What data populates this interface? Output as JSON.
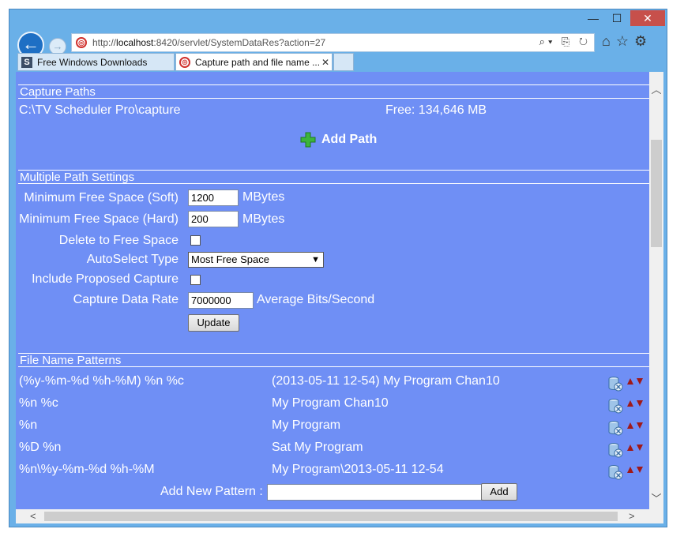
{
  "window": {
    "minimize": "—",
    "maximize": "☐",
    "close": "✕"
  },
  "nav": {
    "url_prefix": "http://",
    "url_host": "localhost",
    "url_rest": ":8420/servlet/SystemDataRes?action=27",
    "tools": "⌕▾ ⎘ ↻",
    "home_icon": "⌂",
    "star_icon": "☆",
    "gear_icon": "⚙"
  },
  "tabs": [
    {
      "label": "Free Windows Downloads",
      "icon": "S"
    },
    {
      "label": "Capture path and file name ...",
      "icon": "◎",
      "close": "✕"
    }
  ],
  "capture_paths": {
    "heading": "Capture Paths",
    "path": "C:\\TV Scheduler Pro\\capture",
    "free": "Free: 134,646 MB",
    "add_path": "Add Path"
  },
  "multi_path": {
    "heading": "Multiple Path Settings",
    "min_soft_label": "Minimum Free Space (Soft)",
    "min_soft_value": "1200",
    "min_soft_unit": "MBytes",
    "min_hard_label": "Minimum Free Space (Hard)",
    "min_hard_value": "200",
    "min_hard_unit": "MBytes",
    "delete_label": "Delete to Free Space",
    "autoselect_label": "AutoSelect Type",
    "autoselect_value": "Most Free Space",
    "include_label": "Include Proposed Capture",
    "rate_label": "Capture Data Rate",
    "rate_value": "7000000",
    "rate_unit": "Average Bits/Second",
    "update": "Update"
  },
  "file_patterns": {
    "heading": "File Name Patterns",
    "rows": [
      {
        "pattern": "(%y-%m-%d %h-%M) %n %c",
        "example": "(2013-05-11 12-54) My Program Chan10"
      },
      {
        "pattern": "%n %c",
        "example": "My Program Chan10"
      },
      {
        "pattern": "%n",
        "example": "My Program"
      },
      {
        "pattern": "%D %n",
        "example": "Sat My Program"
      },
      {
        "pattern": "%n\\%y-%m-%d %h-%M",
        "example": "My Program\\2013-05-11 12-54"
      }
    ],
    "add_label": "Add New Pattern :",
    "add_placeholder": "",
    "add_button": "Add"
  },
  "colors": {
    "page_bg": "#6f8ff5",
    "frame": "#6ab0e8",
    "text": "#ffffff",
    "arrow": "#a01818"
  }
}
